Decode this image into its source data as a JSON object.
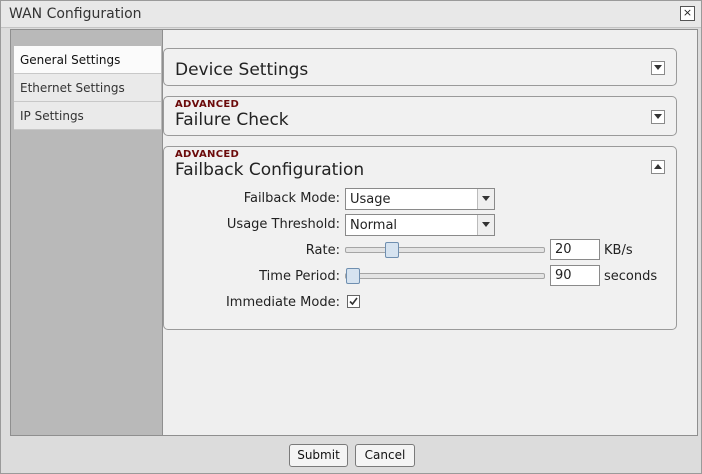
{
  "window": {
    "title": "WAN Configuration",
    "close_glyph": "×"
  },
  "sidebar": {
    "items": [
      {
        "label": "General Settings",
        "active": true
      },
      {
        "label": "Ethernet Settings",
        "active": false
      },
      {
        "label": "IP Settings",
        "active": false
      }
    ]
  },
  "sections": {
    "device_settings": {
      "title": "Device Settings",
      "expanded": false
    },
    "failure_check": {
      "badge": "ADVANCED",
      "title": "Failure Check",
      "expanded": false
    },
    "failback": {
      "badge": "ADVANCED",
      "title": "Failback Configuration",
      "expanded": true,
      "failback_mode": {
        "label": "Failback Mode:",
        "value": "Usage"
      },
      "usage_threshold": {
        "label": "Usage Threshold:",
        "value": "Normal"
      },
      "rate": {
        "label": "Rate:",
        "value": "20",
        "unit": "KB/s",
        "slider_fraction": 0.21
      },
      "time_period": {
        "label": "Time Period:",
        "value": "90",
        "unit": "seconds",
        "slider_fraction": 0.0
      },
      "immediate_mode": {
        "label": "Immediate Mode:",
        "checked": true
      }
    }
  },
  "footer": {
    "submit_label": "Submit",
    "cancel_label": "Cancel"
  },
  "colors": {
    "advanced_badge": "#6b0a0a",
    "sidebar_bg": "#b9b9b9",
    "slider_thumb": "#d6e3f0"
  }
}
